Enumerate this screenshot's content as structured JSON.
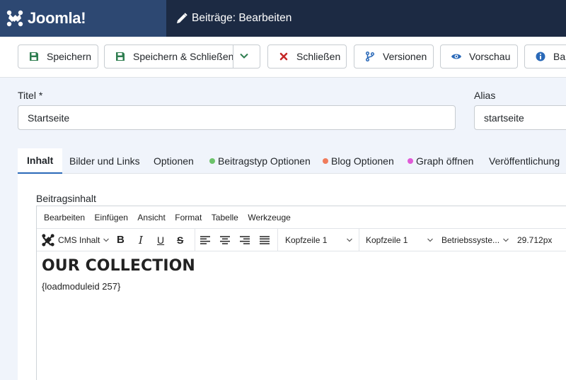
{
  "header": {
    "logo_text": "Joomla!",
    "page_title": "Beiträge: Bearbeiten"
  },
  "toolbar": {
    "save_label": "Speichern",
    "save_close_label": "Speichern & Schließen",
    "close_label": "Schließen",
    "versions_label": "Versionen",
    "preview_label": "Vorschau",
    "help_label": "Ba"
  },
  "form": {
    "title_label": "Titel *",
    "title_value": "Startseite",
    "alias_label": "Alias",
    "alias_value": "startseite"
  },
  "tabs": [
    {
      "label": "Inhalt"
    },
    {
      "label": "Bilder und Links"
    },
    {
      "label": "Optionen"
    },
    {
      "label": "Beitragstyp Optionen",
      "dot": "#6cc36a"
    },
    {
      "label": "Blog Optionen",
      "dot": "#f07c5c"
    },
    {
      "label": "Graph öffnen",
      "dot": "#e05ad7"
    },
    {
      "label": "Veröffentlichung"
    }
  ],
  "editor": {
    "label": "Beitragsinhalt",
    "menu": [
      "Bearbeiten",
      "Einfügen",
      "Ansicht",
      "Format",
      "Tabelle",
      "Werkzeuge"
    ],
    "cms_label": "CMS Inhalt",
    "block_format_1": "Kopfzeile 1",
    "block_format_2": "Kopfzeile 1",
    "font_family": "Betriebssyste...",
    "font_size": "29.712px",
    "heading": "OUR COLLECTION",
    "paragraph": "{loadmoduleid 257}"
  },
  "colors": {
    "header_bg": "#1c2a43",
    "logo_bg": "#2d4872",
    "save_icon": "#2e7d4f",
    "close_icon": "#c52827",
    "accent": "#2a69b8"
  }
}
